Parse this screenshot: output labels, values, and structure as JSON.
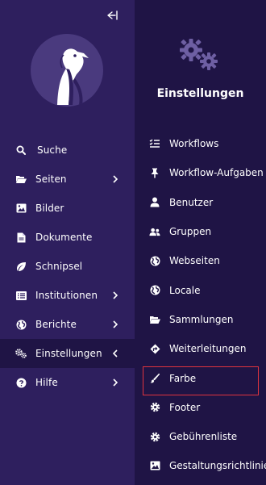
{
  "sidebar": {
    "items": [
      {
        "label": "Suche",
        "icon": "search-icon",
        "has_chevron": false
      },
      {
        "label": "Seiten",
        "icon": "folder-open-icon",
        "has_chevron": true
      },
      {
        "label": "Bilder",
        "icon": "image-icon",
        "has_chevron": false
      },
      {
        "label": "Dokumente",
        "icon": "document-icon",
        "has_chevron": false
      },
      {
        "label": "Schnipsel",
        "icon": "leaf-icon",
        "has_chevron": false
      },
      {
        "label": "Institutionen",
        "icon": "list-icon",
        "has_chevron": true
      },
      {
        "label": "Berichte",
        "icon": "globe-icon",
        "has_chevron": true
      },
      {
        "label": "Einstellungen",
        "icon": "cogs-icon",
        "has_chevron": true,
        "active": true
      },
      {
        "label": "Hilfe",
        "icon": "help-icon",
        "has_chevron": true
      }
    ]
  },
  "panel": {
    "title": "Einstellungen",
    "items": [
      {
        "label": "Workflows",
        "icon": "workflows-icon"
      },
      {
        "label": "Workflow-Aufgaben",
        "icon": "pin-icon"
      },
      {
        "label": "Benutzer",
        "icon": "user-icon"
      },
      {
        "label": "Gruppen",
        "icon": "group-icon"
      },
      {
        "label": "Webseiten",
        "icon": "globe-icon"
      },
      {
        "label": "Locale",
        "icon": "globe-icon"
      },
      {
        "label": "Sammlungen",
        "icon": "folder-open-icon"
      },
      {
        "label": "Weiterleitungen",
        "icon": "redirect-icon"
      },
      {
        "label": "Farbe",
        "icon": "brush-icon",
        "highlighted": true
      },
      {
        "label": "Footer",
        "icon": "cog-icon"
      },
      {
        "label": "Gebührenliste",
        "icon": "cog-icon"
      },
      {
        "label": "Gestaltungsrichtlinie",
        "icon": "image-icon"
      }
    ]
  },
  "colors": {
    "sidebar_bg": "#2e1f5e",
    "panel_bg": "#1f1445",
    "logo_circle": "#4a3a7e",
    "highlight_border": "#e0343e",
    "text": "#ffffff"
  }
}
